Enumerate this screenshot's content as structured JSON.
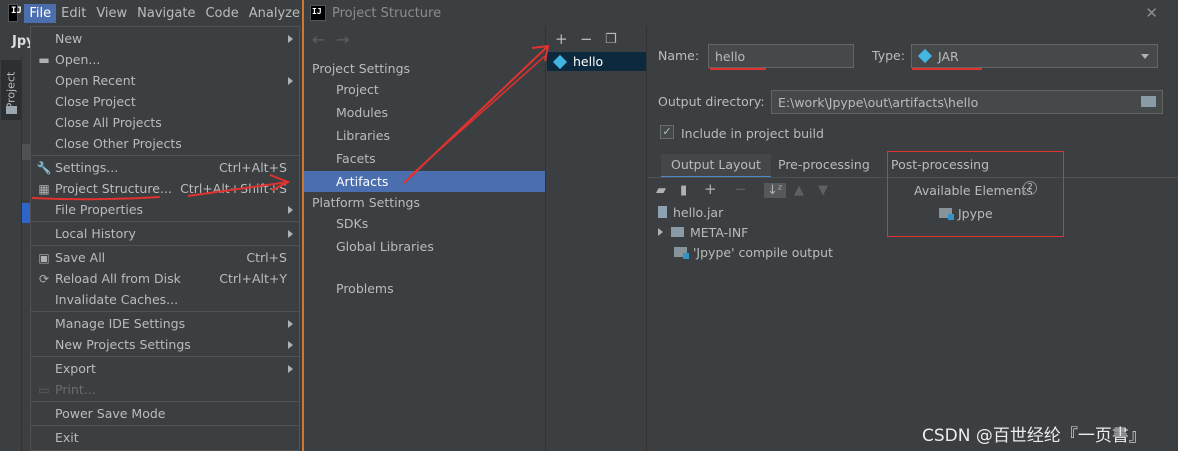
{
  "ide": {
    "project_name": "Jpy",
    "sidebar_tab": "Project",
    "menubar": [
      {
        "label": "File",
        "active": true
      },
      {
        "label": "Edit",
        "active": false
      },
      {
        "label": "View",
        "active": false
      },
      {
        "label": "Navigate",
        "active": false
      },
      {
        "label": "Code",
        "active": false
      },
      {
        "label": "Analyze",
        "active": false
      }
    ]
  },
  "file_menu": {
    "items": [
      {
        "label": "New",
        "shortcut": "",
        "submenu": true,
        "icon": "",
        "disabled": false
      },
      {
        "label": "Open...",
        "shortcut": "",
        "submenu": false,
        "icon": "folder-open-icon",
        "disabled": false
      },
      {
        "label": "Open Recent",
        "shortcut": "",
        "submenu": true,
        "icon": "",
        "disabled": false
      },
      {
        "label": "Close Project",
        "shortcut": "",
        "submenu": false,
        "icon": "",
        "disabled": false
      },
      {
        "label": "Close All Projects",
        "shortcut": "",
        "submenu": false,
        "icon": "",
        "disabled": false
      },
      {
        "label": "Close Other Projects",
        "shortcut": "",
        "submenu": false,
        "icon": "",
        "disabled": false
      },
      {
        "label": "Settings...",
        "shortcut": "Ctrl+Alt+S",
        "submenu": false,
        "icon": "wrench-icon",
        "disabled": false
      },
      {
        "label": "Project Structure...",
        "shortcut": "Ctrl+Alt+Shift+S",
        "submenu": false,
        "icon": "project-structure-icon",
        "disabled": false
      },
      {
        "label": "File Properties",
        "shortcut": "",
        "submenu": true,
        "icon": "",
        "disabled": false
      },
      {
        "label": "Local History",
        "shortcut": "",
        "submenu": true,
        "icon": "",
        "disabled": false
      },
      {
        "label": "Save All",
        "shortcut": "Ctrl+S",
        "submenu": false,
        "icon": "save-icon",
        "disabled": false
      },
      {
        "label": "Reload All from Disk",
        "shortcut": "Ctrl+Alt+Y",
        "submenu": false,
        "icon": "reload-icon",
        "disabled": false
      },
      {
        "label": "Invalidate Caches...",
        "shortcut": "",
        "submenu": false,
        "icon": "",
        "disabled": false
      },
      {
        "label": "Manage IDE Settings",
        "shortcut": "",
        "submenu": true,
        "icon": "",
        "disabled": false
      },
      {
        "label": "New Projects Settings",
        "shortcut": "",
        "submenu": true,
        "icon": "",
        "disabled": false
      },
      {
        "label": "Export",
        "shortcut": "",
        "submenu": true,
        "icon": "",
        "disabled": false
      },
      {
        "label": "Print...",
        "shortcut": "",
        "submenu": false,
        "icon": "print-icon",
        "disabled": true
      },
      {
        "label": "Power Save Mode",
        "shortcut": "",
        "submenu": false,
        "icon": "",
        "disabled": false
      },
      {
        "label": "Exit",
        "shortcut": "",
        "submenu": false,
        "icon": "",
        "disabled": false
      }
    ]
  },
  "dialog": {
    "title": "Project Structure",
    "nav": {
      "project_settings_header": "Project Settings",
      "project_settings": [
        "Project",
        "Modules",
        "Libraries",
        "Facets",
        "Artifacts"
      ],
      "selected": "Artifacts",
      "platform_settings_header": "Platform Settings",
      "platform_settings": [
        "SDKs",
        "Global Libraries"
      ],
      "problems": "Problems"
    },
    "artifacts_list": [
      "hello"
    ],
    "name_label": "Name:",
    "name_value": "hello",
    "type_label": "Type:",
    "type_value": "JAR",
    "output_dir_label": "Output directory:",
    "output_dir_value": "E:\\work\\Jpype\\out\\artifacts\\hello",
    "include_in_build_label": "Include in project build",
    "include_in_build_checked": true,
    "tabs": [
      "Output Layout",
      "Pre-processing",
      "Post-processing"
    ],
    "selected_tab": "Output Layout",
    "layout_tree": {
      "root": "hello.jar",
      "children": [
        "META-INF",
        "'Jpype' compile output"
      ]
    },
    "available_elements_label": "Available Elements",
    "available_elements": [
      "Jpype"
    ]
  },
  "watermark": "CSDN @百世经纶『一页書』",
  "colors": {
    "selection": "#4b6eaf",
    "annotation_red": "#e0322f",
    "dialog_border": "#cc7832"
  }
}
